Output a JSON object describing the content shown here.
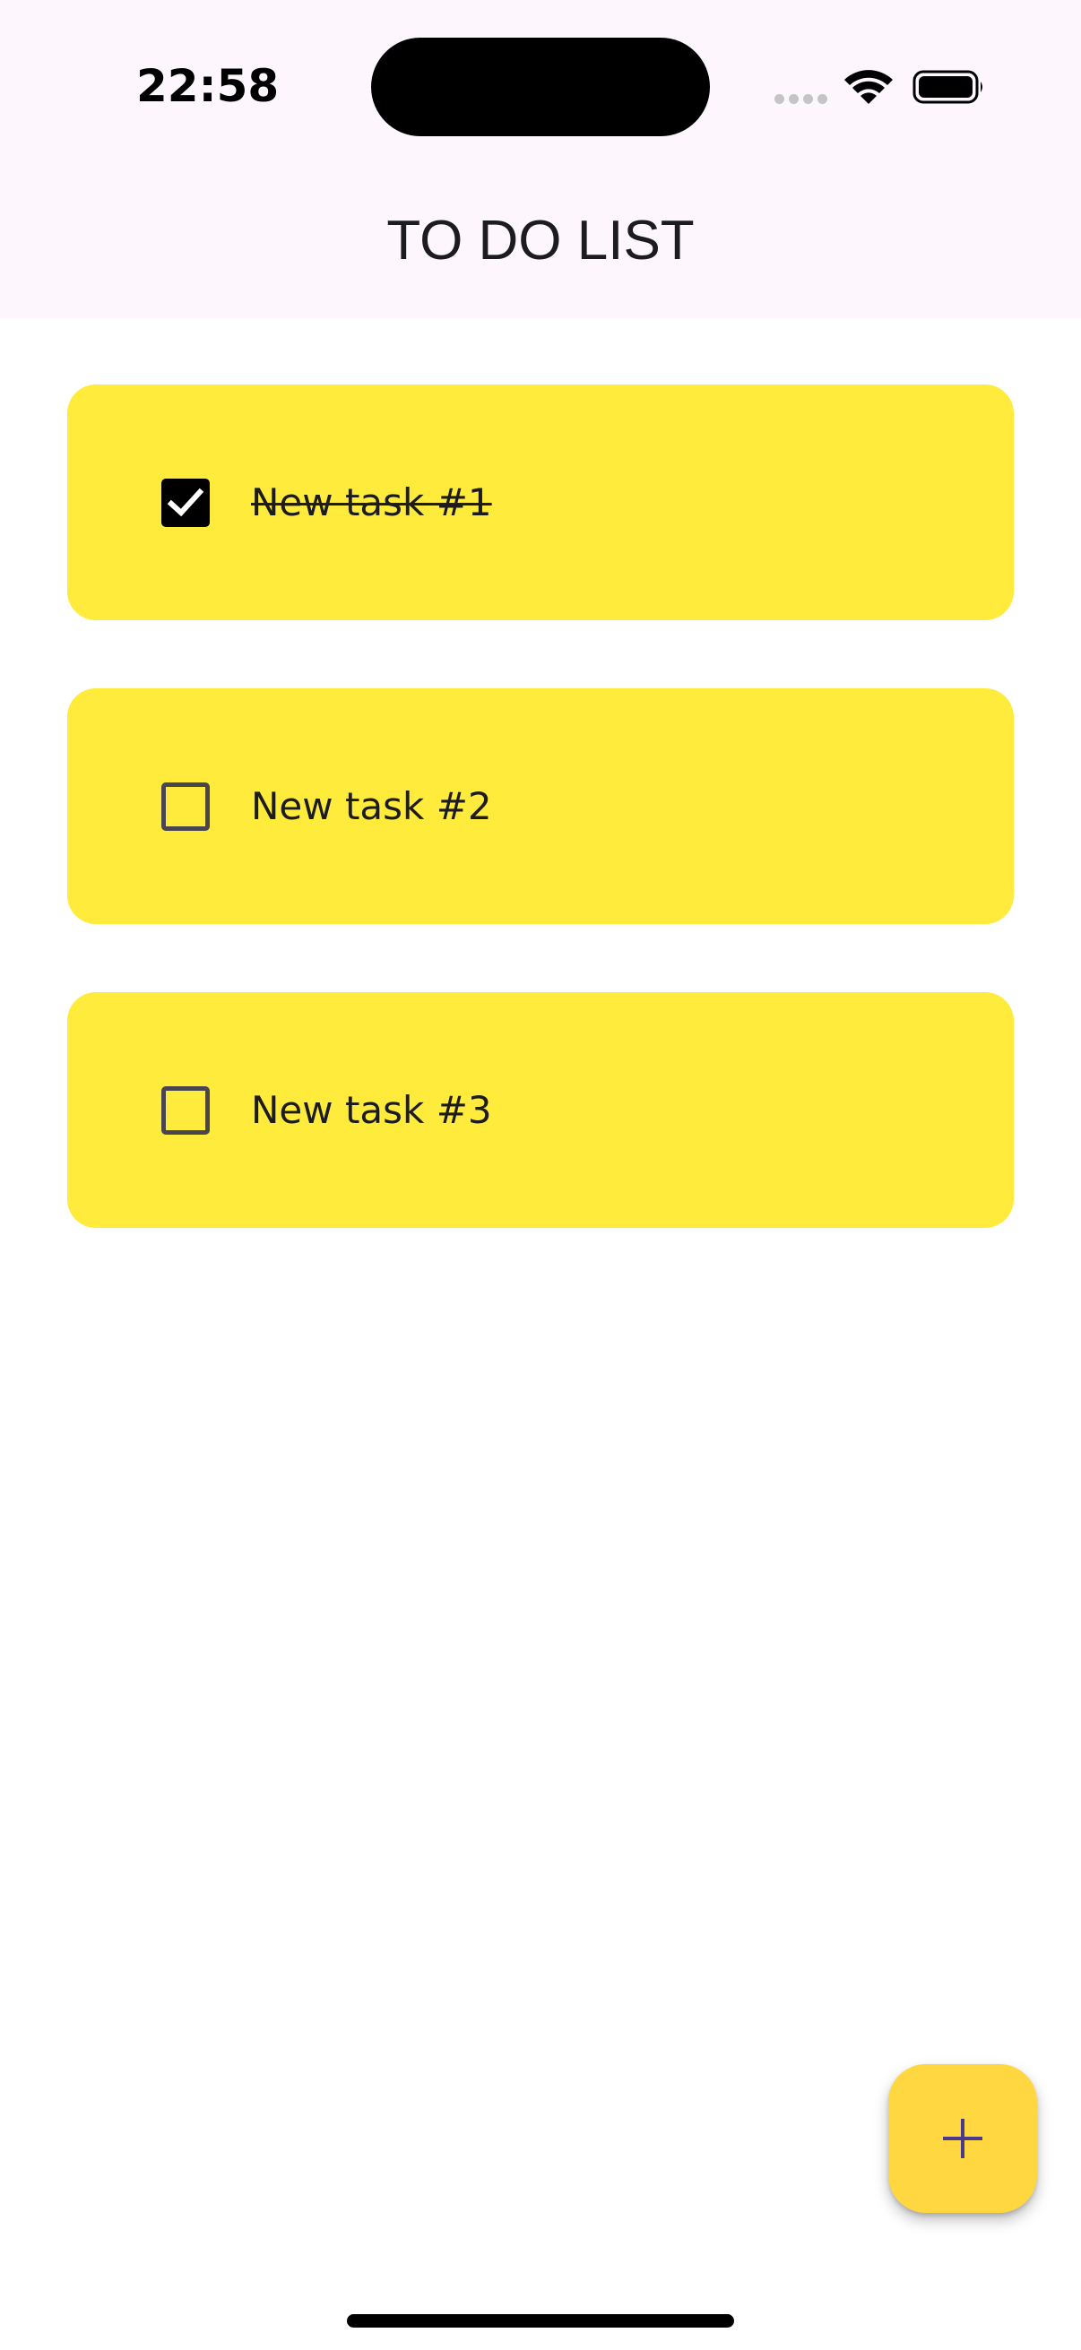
{
  "status_bar": {
    "time": "22:58",
    "icons": [
      "signal-dots-icon",
      "wifi-icon",
      "battery-icon"
    ]
  },
  "header": {
    "title": "TO DO LIST"
  },
  "tasks": [
    {
      "label": "New task #1",
      "completed": true
    },
    {
      "label": "New task #2",
      "completed": false
    },
    {
      "label": "New task #3",
      "completed": false
    }
  ],
  "fab": {
    "icon": "plus-icon"
  },
  "colors": {
    "header_background": "#fdf6fd",
    "card_background": "#ffeb3b",
    "fab_background": "#ffd740",
    "fab_icon": "#4a3a8c",
    "text": "#1c1b1f"
  }
}
